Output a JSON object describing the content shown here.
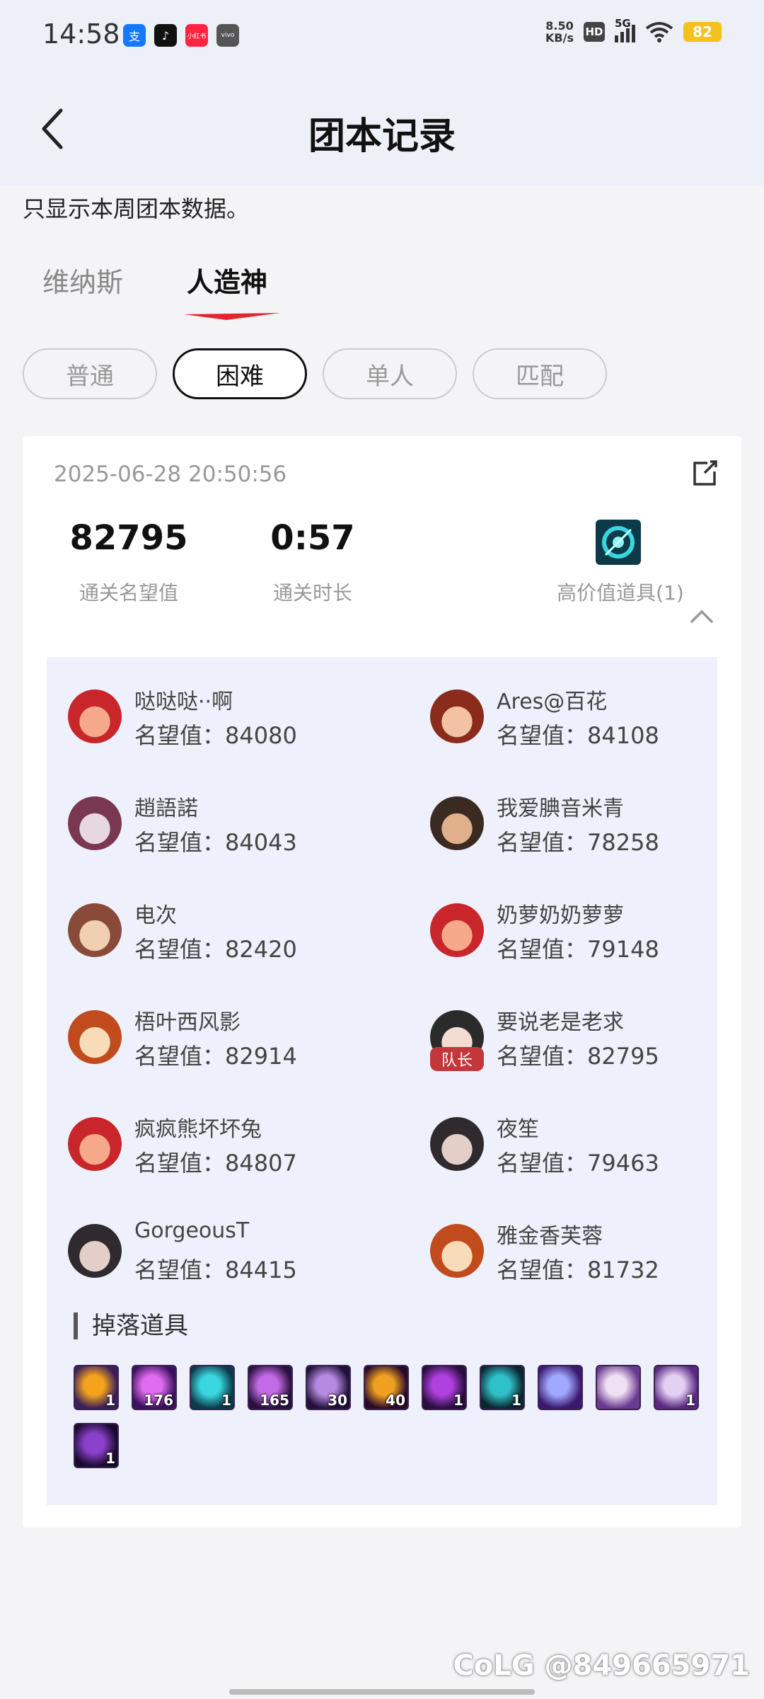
{
  "status": {
    "time": "14:58",
    "net_speed_value": "8.50",
    "net_speed_unit": "KB/s",
    "hd": "HD",
    "network": "5G",
    "battery": "82",
    "apps": [
      {
        "icon": "alipay-icon",
        "color": "#1677ff",
        "glyph": "支"
      },
      {
        "icon": "tiktok-icon",
        "color": "#111111",
        "glyph": "♪"
      },
      {
        "icon": "xiaohongshu-icon",
        "color": "#ff2442",
        "glyph": "小红书"
      },
      {
        "icon": "vivo-icon",
        "color": "#555555",
        "glyph": "vivo"
      }
    ]
  },
  "header": {
    "title": "团本记录"
  },
  "notice": "只显示本周团本数据。",
  "raid_tabs": [
    "维纳斯",
    "人造神"
  ],
  "active_raid_tab": "人造神",
  "difficulty": [
    "普通",
    "困难",
    "单人",
    "匹配"
  ],
  "active_difficulty": "困难",
  "record": {
    "datetime": "2025-06-28 20:50:56",
    "reputation": "82795",
    "reputation_label": "通关名望值",
    "duration": "0:57",
    "duration_label": "通关时长",
    "high_value_label": "高价值道具(1)"
  },
  "members": [
    {
      "name": "哒哒哒··啊",
      "score": "名望值：84080",
      "leader": false,
      "avatar": [
        "#f6a88a",
        "#c8262b"
      ]
    },
    {
      "name": "Ares@百花",
      "score": "名望值：84108",
      "leader": false,
      "avatar": [
        "#f3c2a4",
        "#8a2b1c"
      ]
    },
    {
      "name": "趙語諾",
      "score": "名望值：84043",
      "leader": false,
      "avatar": [
        "#e7d8e0",
        "#7a3850"
      ]
    },
    {
      "name": "我爱腆音米青",
      "score": "名望值：78258",
      "leader": false,
      "avatar": [
        "#e0b08a",
        "#3a2a22"
      ]
    },
    {
      "name": "电次",
      "score": "名望值：82420",
      "leader": false,
      "avatar": [
        "#f0d0b0",
        "#8a4a3a"
      ]
    },
    {
      "name": "奶萝奶奶萝萝",
      "score": "名望值：79148",
      "leader": false,
      "avatar": [
        "#f6a88a",
        "#c8262b"
      ]
    },
    {
      "name": "梧叶西风影",
      "score": "名望值：82914",
      "leader": false,
      "avatar": [
        "#f8dcb8",
        "#c24b1e"
      ]
    },
    {
      "name": "要说老是老求",
      "score": "名望值：82795",
      "leader": true,
      "leader_label": "队长",
      "avatar": [
        "#f2ddd0",
        "#2b2b2b"
      ]
    },
    {
      "name": "疯疯熊坏坏兔",
      "score": "名望值：84807",
      "leader": false,
      "avatar": [
        "#f6a88a",
        "#c8262b"
      ]
    },
    {
      "name": "夜笙",
      "score": "名望值：79463",
      "leader": false,
      "avatar": [
        "#e3cfc8",
        "#2e2a2e"
      ]
    },
    {
      "name": "GorgeousT",
      "score": "名望值：84415",
      "leader": false,
      "avatar": [
        "#e3cfc8",
        "#2e2a2e"
      ]
    },
    {
      "name": "雅金香芙蓉",
      "score": "名望值：81732",
      "leader": false,
      "avatar": [
        "#f8dcb8",
        "#c24b1e"
      ]
    }
  ],
  "drops_title": "掉落道具",
  "drops": [
    {
      "count": "1",
      "colors": [
        "#f4a21c",
        "#3a1f5a"
      ]
    },
    {
      "count": "176",
      "colors": [
        "#e06cf0",
        "#3b1060"
      ]
    },
    {
      "count": "1",
      "colors": [
        "#39d6e0",
        "#0c3a48"
      ]
    },
    {
      "count": "165",
      "colors": [
        "#c36be6",
        "#2a1040"
      ]
    },
    {
      "count": "30",
      "colors": [
        "#b58ae0",
        "#22103a"
      ]
    },
    {
      "count": "40",
      "colors": [
        "#f0a020",
        "#2a0a2a"
      ]
    },
    {
      "count": "1",
      "colors": [
        "#b040e0",
        "#2a0d40"
      ]
    },
    {
      "count": "1",
      "colors": [
        "#30c0c8",
        "#0b2630"
      ]
    },
    {
      "count": "",
      "colors": [
        "#a0a8ff",
        "#3a1870"
      ]
    },
    {
      "count": "",
      "colors": [
        "#f0e0f4",
        "#6a3a90"
      ]
    },
    {
      "count": "1",
      "colors": [
        "#e4d0f4",
        "#5a2880"
      ]
    },
    {
      "count": "1",
      "colors": [
        "#8a40c8",
        "#1a0a30"
      ]
    }
  ],
  "watermark": "@849665971"
}
